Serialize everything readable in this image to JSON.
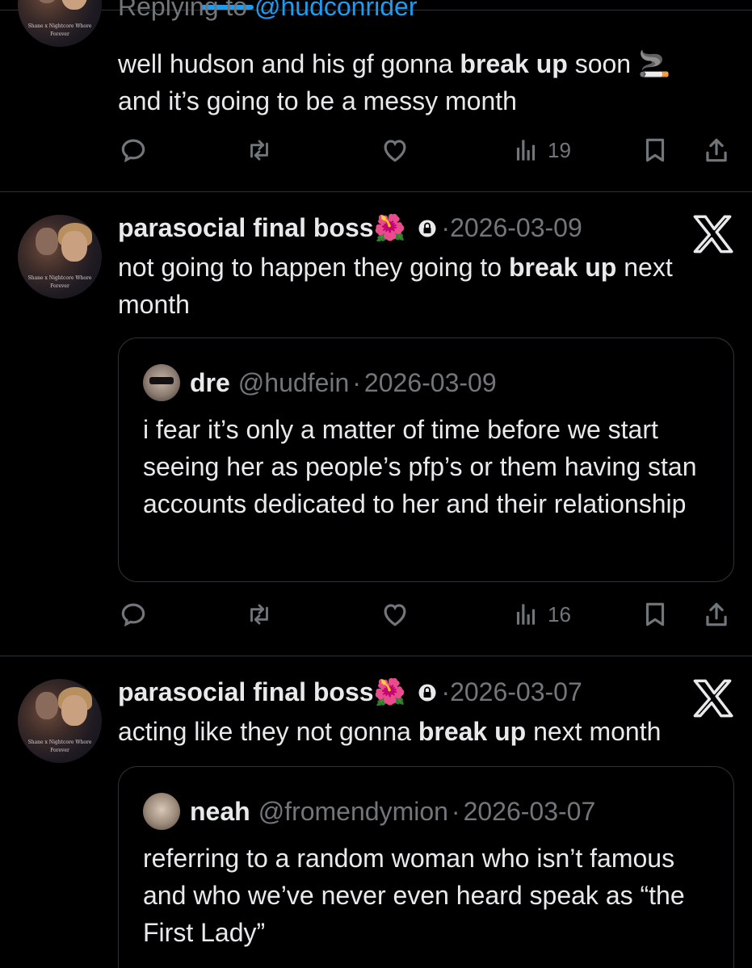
{
  "replying": {
    "prefix": "Replying to",
    "handle": "@hudconrider"
  },
  "tweets": [
    {
      "body_before": "well hudson and his gf gonna ",
      "body_bold": "break up",
      "body_after": " soon 🚬",
      "body_line2": "and it’s going to be a messy month",
      "views": "19",
      "avatar_caption": "Shane x Nightcore Whore Forever"
    },
    {
      "name": "parasocial final boss",
      "name_emoji": "🌺",
      "dot": "·",
      "date": "2026-03-09",
      "body_before": "not going to happen they going to ",
      "body_bold": "break up",
      "body_after": " next month",
      "quote": {
        "name": "dre",
        "handle": "@hudfein",
        "dot": "·",
        "date": "2026-03-09",
        "text": "i fear it’s only a matter of time before we start seeing her as people’s pfp’s or them having stan accounts dedicated to her and their relationship"
      },
      "views": "16",
      "avatar_caption": "Shane x Nightcore Whore Forever"
    },
    {
      "name": "parasocial final boss",
      "name_emoji": "🌺",
      "dot": "·",
      "date": "2026-03-07",
      "body_before": "acting like they not gonna ",
      "body_bold": "break up",
      "body_after": " next month",
      "quote": {
        "name": "neah",
        "handle": "@fromendymion",
        "dot": "·",
        "date": "2026-03-07",
        "text": "referring to a random woman who isn’t famous and who we’ve never even heard speak as “the First Lady”"
      },
      "avatar_caption": "Shane x Nightcore Whore Forever"
    }
  ],
  "icons": {
    "reply": "reply-icon",
    "retweet": "retweet-icon",
    "like": "heart-icon",
    "views": "views-icon",
    "bookmark": "bookmark-icon",
    "share": "share-icon",
    "lock": "lock-icon",
    "platform": "x-logo-icon"
  },
  "colors": {
    "background": "#000000",
    "text": "#e7e9ea",
    "muted": "#71767b",
    "accent": "#1d9bf0",
    "divider": "#2f3336"
  }
}
